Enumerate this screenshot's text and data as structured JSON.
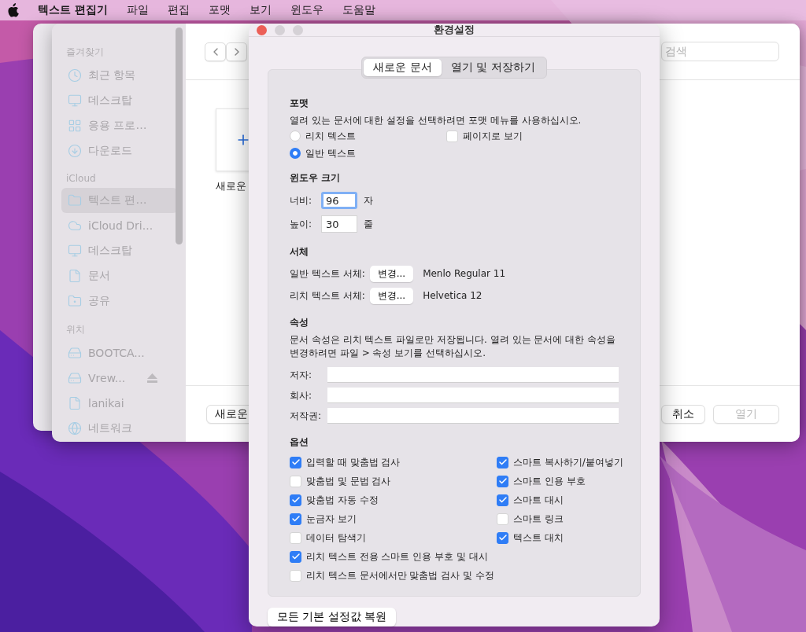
{
  "menu_bar": {
    "app_name": "텍스트 편집기",
    "items": [
      "파일",
      "편집",
      "포맷",
      "보기",
      "윈도우",
      "도움말"
    ]
  },
  "open_dialog": {
    "sidebar": {
      "sections": [
        {
          "title": "즐겨찾기",
          "items": [
            {
              "label": "최근 항목",
              "kind": "clock",
              "selected": false
            },
            {
              "label": "데스크탑",
              "kind": "desktop",
              "selected": false
            },
            {
              "label": "응용 프로…",
              "kind": "apps",
              "selected": false
            },
            {
              "label": "다운로드",
              "kind": "download",
              "selected": false
            }
          ]
        },
        {
          "title": "iCloud",
          "items": [
            {
              "label": "텍스트 편…",
              "kind": "folder",
              "selected": true
            },
            {
              "label": "iCloud Dri...",
              "kind": "cloud",
              "selected": false
            },
            {
              "label": "데스크탑",
              "kind": "desktop",
              "selected": false
            },
            {
              "label": "문서",
              "kind": "document",
              "selected": false
            },
            {
              "label": "공유",
              "kind": "shared",
              "selected": false
            }
          ]
        },
        {
          "title": "위치",
          "items": [
            {
              "label": "BOOTCA...",
              "kind": "drive",
              "selected": false
            },
            {
              "label": "Vrew...",
              "kind": "drive",
              "selected": false,
              "ejectable": true
            },
            {
              "label": "lanikai",
              "kind": "document",
              "selected": false
            },
            {
              "label": "네트워크",
              "kind": "network",
              "selected": false
            }
          ]
        }
      ]
    },
    "search": {
      "placeholder": "검색"
    },
    "new_document_label": "새로운",
    "buttons": [
      {
        "label": "새로운",
        "disabled": false
      },
      {
        "label": "취소",
        "disabled": false
      },
      {
        "label": "열기",
        "disabled": true
      }
    ]
  },
  "preferences": {
    "title": "환경설정",
    "tabs": [
      {
        "label": "새로운 문서",
        "selected": true
      },
      {
        "label": "열기 및 저장하기",
        "selected": false
      }
    ],
    "format": {
      "heading": "포맷",
      "description": "열려 있는 문서에 대한 설정을 선택하려면 포맷 메뉴를 사용하십시오.",
      "options": [
        {
          "label": "리치 텍스트",
          "selected": false
        },
        {
          "label": "일반 텍스트",
          "selected": true
        }
      ],
      "page_view": {
        "label": "페이지로 보기",
        "checked": false
      }
    },
    "window_size": {
      "heading": "윈도우 크기",
      "fields": [
        {
          "label": "너비:",
          "value": "96",
          "unit": "자",
          "focused": true
        },
        {
          "label": "높이:",
          "value": "30",
          "unit": "줄",
          "focused": false
        }
      ]
    },
    "fonts": {
      "heading": "서체",
      "rows": [
        {
          "label": "일반 텍스트 서체:",
          "button": "변경...",
          "value": "Menlo Regular 11"
        },
        {
          "label": "리치 텍스트 서체:",
          "button": "변경...",
          "value": "Helvetica 12"
        }
      ]
    },
    "properties": {
      "heading": "속성",
      "description": "문서 속성은 리치 텍스트 파일로만 저장됩니다. 열려 있는 문서에 대한 속성을 변경하려면 파일 > 속성 보기를 선택하십시오.",
      "fields": [
        {
          "label": "저자:"
        },
        {
          "label": "회사:"
        },
        {
          "label": "저작권:"
        }
      ]
    },
    "options": {
      "heading": "옵션",
      "left": [
        {
          "label": "입력할 때 맞춤법 검사",
          "checked": true
        },
        {
          "label": "맞춤법 및 문법 검사",
          "checked": false
        },
        {
          "label": "맞춤법 자동 수정",
          "checked": true
        },
        {
          "label": "눈금자 보기",
          "checked": true
        },
        {
          "label": "데이터 탐색기",
          "checked": false
        }
      ],
      "right": [
        {
          "label": "스마트 복사하기/붙여넣기",
          "checked": true
        },
        {
          "label": "스마트 인용 부호",
          "checked": true
        },
        {
          "label": "스마트 대시",
          "checked": true
        },
        {
          "label": "스마트 링크",
          "checked": false
        },
        {
          "label": "텍스트 대치",
          "checked": true
        }
      ],
      "full": [
        {
          "label": "리치 텍스트 전용 스마트 인용 부호 및 대시",
          "checked": true
        },
        {
          "label": "리치 텍스트 문서에서만 맞춤법 검사 및 수정",
          "checked": false
        }
      ]
    },
    "restore_button": "모든 기본 설정값 복원"
  }
}
